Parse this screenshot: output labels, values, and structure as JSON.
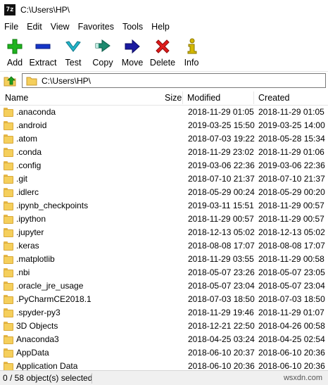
{
  "window": {
    "title": "C:\\Users\\HP\\",
    "app_icon_text": "7z"
  },
  "menu": [
    "File",
    "Edit",
    "View",
    "Favorites",
    "Tools",
    "Help"
  ],
  "toolbar": [
    {
      "label": "Add",
      "icon": "plus-icon",
      "color": "#1fb31f"
    },
    {
      "label": "Extract",
      "icon": "minus-icon",
      "color": "#1536c8"
    },
    {
      "label": "Test",
      "icon": "checkmark-icon",
      "color": "#22b5c9"
    },
    {
      "label": "Copy",
      "icon": "double-arrow-icon",
      "color": "#1e8a6f"
    },
    {
      "label": "Move",
      "icon": "arrow-right-icon",
      "color": "#1a1aa0"
    },
    {
      "label": "Delete",
      "icon": "x-icon",
      "color": "#e01b1b"
    },
    {
      "label": "Info",
      "icon": "info-icon",
      "color": "#d4b800"
    }
  ],
  "address": {
    "path": "C:\\Users\\HP\\"
  },
  "columns": {
    "name": "Name",
    "size": "Size",
    "modified": "Modified",
    "created": "Created"
  },
  "files": [
    {
      "name": ".anaconda",
      "size": "",
      "modified": "2018-11-29 01:05",
      "created": "2018-11-29 01:05"
    },
    {
      "name": ".android",
      "size": "",
      "modified": "2019-03-25 15:50",
      "created": "2019-03-25 14:00"
    },
    {
      "name": ".atom",
      "size": "",
      "modified": "2018-07-03 19:22",
      "created": "2018-05-28 15:34"
    },
    {
      "name": ".conda",
      "size": "",
      "modified": "2018-11-29 23:02",
      "created": "2018-11-29 01:06"
    },
    {
      "name": ".config",
      "size": "",
      "modified": "2019-03-06 22:36",
      "created": "2019-03-06 22:36"
    },
    {
      "name": ".git",
      "size": "",
      "modified": "2018-07-10 21:37",
      "created": "2018-07-10 21:37"
    },
    {
      "name": ".idlerc",
      "size": "",
      "modified": "2018-05-29 00:24",
      "created": "2018-05-29 00:20"
    },
    {
      "name": ".ipynb_checkpoints",
      "size": "",
      "modified": "2019-03-11 15:51",
      "created": "2018-11-29 00:57"
    },
    {
      "name": ".ipython",
      "size": "",
      "modified": "2018-11-29 00:57",
      "created": "2018-11-29 00:57"
    },
    {
      "name": ".jupyter",
      "size": "",
      "modified": "2018-12-13 05:02",
      "created": "2018-12-13 05:02"
    },
    {
      "name": ".keras",
      "size": "",
      "modified": "2018-08-08 17:07",
      "created": "2018-08-08 17:07"
    },
    {
      "name": ".matplotlib",
      "size": "",
      "modified": "2018-11-29 03:55",
      "created": "2018-11-29 00:58"
    },
    {
      "name": ".nbi",
      "size": "",
      "modified": "2018-05-07 23:26",
      "created": "2018-05-07 23:05"
    },
    {
      "name": ".oracle_jre_usage",
      "size": "",
      "modified": "2018-05-07 23:04",
      "created": "2018-05-07 23:04"
    },
    {
      "name": ".PyCharmCE2018.1",
      "size": "",
      "modified": "2018-07-03 18:50",
      "created": "2018-07-03 18:50"
    },
    {
      "name": ".spyder-py3",
      "size": "",
      "modified": "2018-11-29 19:46",
      "created": "2018-11-29 01:07"
    },
    {
      "name": "3D Objects",
      "size": "",
      "modified": "2018-12-21 22:50",
      "created": "2018-04-26 00:58"
    },
    {
      "name": "Anaconda3",
      "size": "",
      "modified": "2018-04-25 03:24",
      "created": "2018-04-25 02:54"
    },
    {
      "name": "AppData",
      "size": "",
      "modified": "2018-06-10 20:37",
      "created": "2018-06-10 20:36"
    },
    {
      "name": "Application Data",
      "size": "",
      "modified": "2018-06-10 20:36",
      "created": "2018-06-10 20:36"
    }
  ],
  "status": {
    "text": "0 / 58 object(s) selected",
    "watermark": "wsxdn.com"
  }
}
